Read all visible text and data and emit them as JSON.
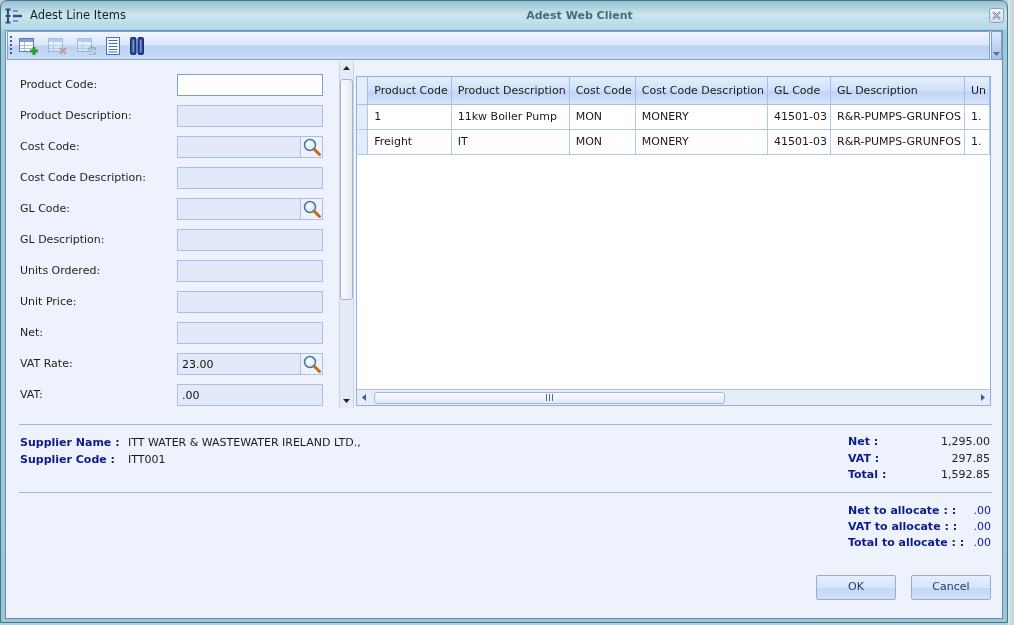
{
  "window": {
    "title": "Adest Line Items",
    "caption": "Adest Web Client"
  },
  "toolbar": [
    {
      "kind": "add",
      "disabled": false
    },
    {
      "kind": "delete",
      "disabled": true
    },
    {
      "kind": "refresh",
      "disabled": true
    },
    {
      "kind": "list",
      "disabled": false
    },
    {
      "kind": "columns",
      "disabled": false
    }
  ],
  "form": {
    "fields": [
      {
        "label": "Product Code:",
        "kind": "text",
        "disabled": false
      },
      {
        "label": "Product Description:",
        "kind": "text",
        "disabled": true
      },
      {
        "label": "Cost Code:",
        "kind": "lookup",
        "disabled": true
      },
      {
        "label": "Cost Code Description:",
        "kind": "text",
        "disabled": true
      },
      {
        "label": "GL Code:",
        "kind": "lookup",
        "disabled": true
      },
      {
        "label": "GL Description:",
        "kind": "text",
        "disabled": true
      },
      {
        "label": "Units Ordered:",
        "kind": "text",
        "disabled": true
      },
      {
        "label": "Unit Price:",
        "kind": "text",
        "disabled": true
      },
      {
        "label": "Net:",
        "kind": "text",
        "disabled": true
      },
      {
        "label": "VAT Rate:",
        "kind": "lookup",
        "disabled": true,
        "value": "23.00"
      },
      {
        "label": "VAT:",
        "kind": "text",
        "disabled": true,
        "value": ".00"
      }
    ]
  },
  "grid": {
    "columns": [
      "Product Code",
      "Product Description",
      "Cost Code",
      "Cost Code Description",
      "GL Code",
      "GL Description",
      "Un"
    ],
    "rows": [
      {
        "cells": [
          "1",
          "11kw Boiler Pump",
          "MON",
          "MONERY",
          "41501-03",
          "R&R-PUMPS-GRUNFOS",
          "1."
        ]
      },
      {
        "cells": [
          "Freight",
          "IT",
          "MON",
          "MONERY",
          "41501-03",
          "R&R-PUMPS-GRUNFOS",
          "1."
        ]
      }
    ]
  },
  "supplier": [
    {
      "label": "Supplier Name :",
      "value": "ITT WATER & WASTEWATER IRELAND LTD.,"
    },
    {
      "label": "Supplier Code :",
      "value": "ITT001"
    }
  ],
  "totals": [
    {
      "label": "Net :",
      "value": "1,295.00"
    },
    {
      "label": "VAT :",
      "value": "297.85"
    },
    {
      "label": "Total :",
      "value": "1,592.85"
    }
  ],
  "allocation": [
    {
      "label": "Net to allocate : :",
      "value": ".00"
    },
    {
      "label": "VAT to allocate : :",
      "value": ".00"
    },
    {
      "label": "Total to allocate : :",
      "value": ".00"
    }
  ],
  "buttons": [
    {
      "label": "OK"
    },
    {
      "label": "Cancel"
    }
  ]
}
